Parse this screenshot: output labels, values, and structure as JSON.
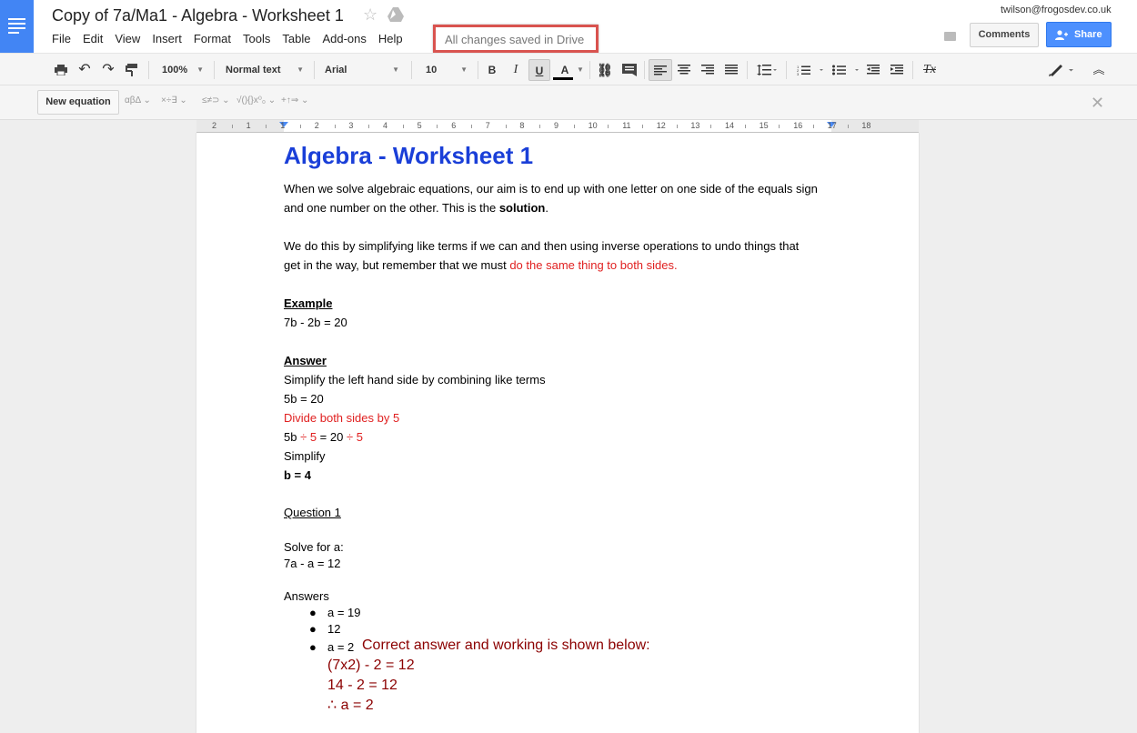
{
  "header": {
    "doc_title": "Copy of 7a/Ma1 - Algebra - Worksheet 1",
    "save_status": "All changes saved in Drive",
    "user_email": "twilson@frogosdev.co.uk",
    "comments_label": "Comments",
    "share_label": "Share",
    "menu": [
      "File",
      "Edit",
      "View",
      "Insert",
      "Format",
      "Tools",
      "Table",
      "Add-ons",
      "Help"
    ]
  },
  "toolbar": {
    "zoom": "100%",
    "style": "Normal text",
    "font": "Arial",
    "size": "10",
    "bold": "B",
    "italic": "I",
    "underline": "U",
    "text_color": "A",
    "clear_format": "Tx"
  },
  "equation_bar": {
    "new_equation": "New equation",
    "greek": "αβΔ",
    "operators": "×÷∃",
    "relations": "≤≠⊃",
    "math": "√(){}x⁰₀",
    "arrows": "+↑⇒",
    "close": "✕"
  },
  "ruler": {
    "labels": [
      "2",
      "1",
      "1",
      "2",
      "3",
      "4",
      "5",
      "6",
      "7",
      "8",
      "9",
      "10",
      "11",
      "12",
      "13",
      "14",
      "15",
      "16",
      "17",
      "18"
    ]
  },
  "document": {
    "title": "Algebra - Worksheet 1",
    "p1_line1": "When we solve algebraic equations, our aim is to end up with one letter on one side of the equals sign",
    "p1_line2_a": "and one number on the other.  This is the ",
    "p1_line2_b": "solution",
    "p1_line2_c": ".",
    "p2_line1": "We do this by simplifying like terms if we can and then using inverse operations to undo things that",
    "p2_line2_a": "get in the way, but remember that we must ",
    "p2_line2_b": "do the same thing to both sides",
    "p2_line2_c": ".",
    "example_heading": "Example",
    "example_eq": "7b - 2b = 20",
    "answer_heading": "Answer",
    "answer_line1": "Simplify the left hand side by combining like terms",
    "answer_line2": "5b = 20",
    "answer_line3": "Divide both sides by 5",
    "answer_line4_a": "5b ",
    "answer_line4_b": "÷ 5",
    "answer_line4_c": " = 20 ",
    "answer_line4_d": "÷ 5",
    "answer_line5": "Simplify",
    "answer_line6": "b = 4",
    "q1_heading": "Question 1",
    "q1_prompt": "Solve for a:",
    "q1_eq": "7a - a = 12",
    "answers_label": "Answers",
    "options": [
      "a = 19",
      "12",
      "a = 2"
    ],
    "feedback_line1": "Correct answer and working is shown below:",
    "feedback_line2": "(7x2) - 2 = 12",
    "feedback_line3": "14 - 2 = 12",
    "feedback_line4": "∴ a = 2"
  },
  "colors": {
    "title_blue": "#1a3fd8",
    "red": "#e02020",
    "dark_red": "#8b0000",
    "share_blue": "#4d90fe",
    "docs_blue": "#4285f4",
    "highlight_border": "#d9534f"
  }
}
